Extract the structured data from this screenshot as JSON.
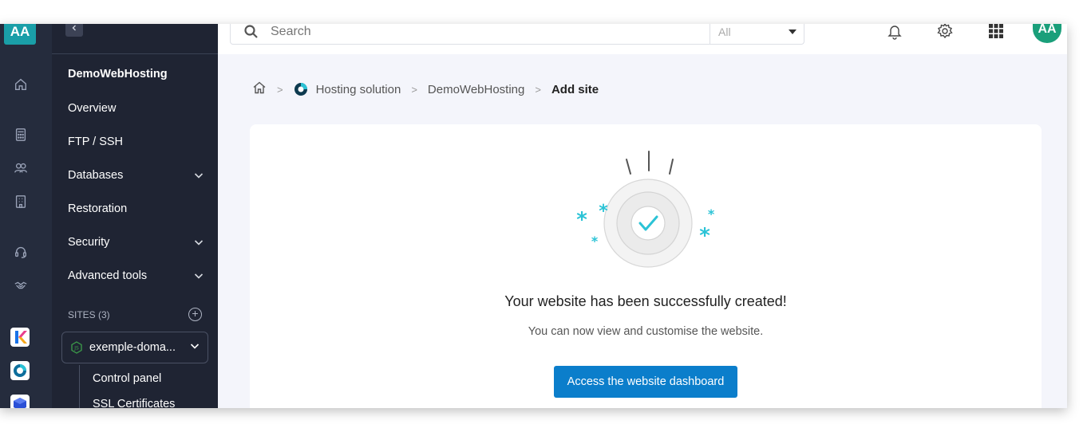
{
  "rail": {
    "avatar": "AA"
  },
  "sidebar": {
    "title": "DemoWebHosting",
    "items": [
      {
        "label": "Overview"
      },
      {
        "label": "FTP / SSH"
      },
      {
        "label": "Databases"
      },
      {
        "label": "Restoration"
      },
      {
        "label": "Security"
      },
      {
        "label": "Advanced tools"
      }
    ],
    "sites_label": "SITES (3)",
    "site_selected": "exemple-doma...",
    "sub_items": [
      {
        "label": "Control panel"
      },
      {
        "label": "SSL Certificates"
      }
    ]
  },
  "topbar": {
    "search_placeholder": "Search",
    "filter_value": "All",
    "avatar": "AA"
  },
  "breadcrumb": {
    "items": [
      "Hosting solution",
      "DemoWebHosting"
    ],
    "current": "Add site"
  },
  "main": {
    "title": "Your website has been successfully created!",
    "subtitle": "You can now view and customise the website.",
    "cta_label": "Access the website dashboard"
  },
  "colors": {
    "accent": "#0b7ecb",
    "brand_teal": "#1a9fa8",
    "sparkle": "#2bc3d6",
    "sidebar_bg": "#1f2433"
  }
}
